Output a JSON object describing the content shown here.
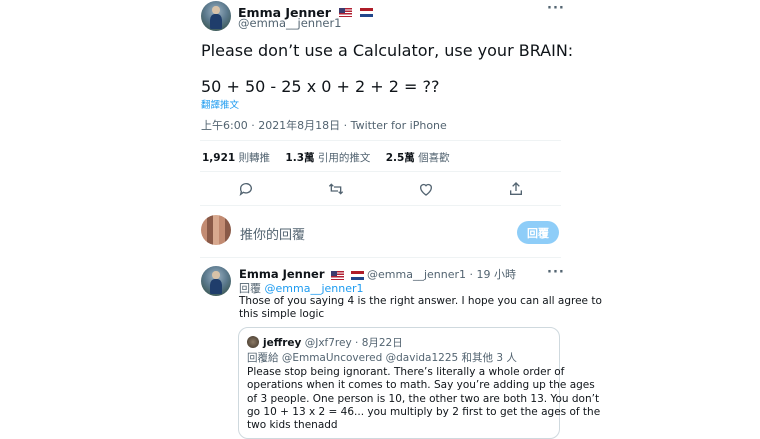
{
  "main_tweet": {
    "author_name": "Emma Jenner",
    "handle": "@emma__jenner1",
    "text_line1": "Please don’t use a Calculator, use your BRAIN:",
    "text_line2": "50 + 50 - 25 x 0 + 2 + 2 = ??",
    "translate_link": "翻譯推文",
    "timestamp": "上午6:00 · 2021年8月18日 · Twitter for iPhone",
    "stats": {
      "retweets_count": "1,921",
      "retweets_label": "則轉推",
      "quotes_count": "1.3萬",
      "quotes_label": "引用的推文",
      "likes_count": "2.5萬",
      "likes_label": "個喜歡"
    }
  },
  "composer": {
    "placeholder": "推你的回覆",
    "reply_button": "回覆"
  },
  "reply_tweet": {
    "author_name": "Emma Jenner",
    "handle": "@emma__jenner1",
    "time": "· 19 小時",
    "replying_to_label": "回覆",
    "replying_to_handle": "@emma__jenner1",
    "text_line1": "Those of you saying 4 is the right answer. I hope you can all agree to",
    "text_line2": "this simple logic",
    "quoted": {
      "author_name": "jeffrey",
      "handle": "@Jxf7rey",
      "date": "· 8月22日",
      "replying_to_label": "回覆給",
      "replying_to_users": "@EmmaUncovered @davida1225 和其他 3 人",
      "lines": [
        "Please stop being ignorant. There’s literally a whole order of",
        "operations when it comes to math. Say you’re adding up the ages",
        "of 3 people. One person is 10, the other two are both 13. You don’t",
        "go 10 + 13 x 2 = 46... you multiply by 2 first to get the ages of the",
        "two kids thenadd"
      ]
    }
  },
  "colors": {
    "accent": "#1d9bf0",
    "muted": "#536471",
    "reply_button_disabled": "#8ecdf8"
  },
  "icons": [
    "more-icon",
    "reply-icon",
    "retweet-icon",
    "like-icon",
    "share-icon",
    "flag-us-icon",
    "flag-nl-icon"
  ]
}
